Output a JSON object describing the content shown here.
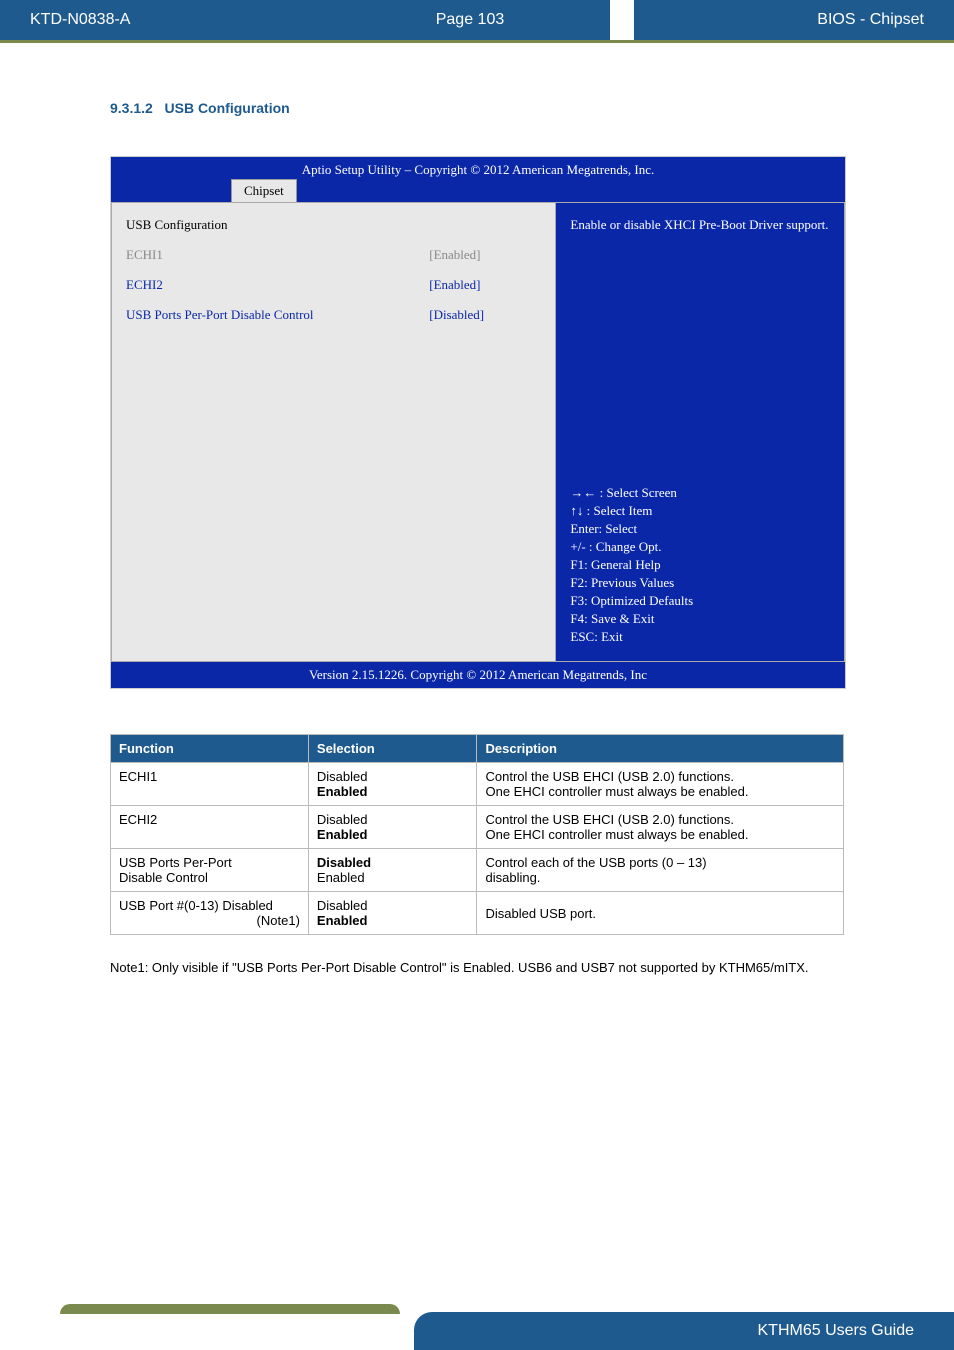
{
  "header": {
    "doc_id": "KTD-N0838-A",
    "page_label": "Page 103",
    "section_name": "BIOS - Chipset"
  },
  "section": {
    "number": "9.3.1.2",
    "title": "USB Configuration"
  },
  "bios": {
    "titlebar": "Aptio Setup Utility  –  Copyright © 2012 American Megatrends, Inc.",
    "tab": "Chipset",
    "heading": "USB Configuration",
    "rows": {
      "echi1": {
        "label": "ECHI1",
        "value": "[Enabled]"
      },
      "echi2": {
        "label": "ECHI2",
        "value": "[Enabled]"
      },
      "usbppd": {
        "label": "USB Ports Per-Port Disable Control",
        "value": "[Disabled]"
      }
    },
    "help_text": "Enable or disable XHCI Pre-Boot Driver support.",
    "keys": {
      "k1": "→← : Select Screen",
      "k2": "↑↓ : Select Item",
      "k3": "Enter: Select",
      "k4": "+/- : Change Opt.",
      "k5": "F1: General Help",
      "k6": "F2: Previous Values",
      "k7": "F3: Optimized Defaults",
      "k8": "F4: Save & Exit",
      "k9": "ESC: Exit"
    },
    "footer": "Version 2.15.1226. Copyright © 2012 American Megatrends, Inc"
  },
  "table": {
    "headers": {
      "function": "Function",
      "selection": "Selection",
      "description": "Description"
    },
    "rows": [
      {
        "function": "ECHI1",
        "sel_normal": "Disabled",
        "sel_default": "Enabled",
        "desc_l1": "Control the USB EHCI (USB 2.0) functions.",
        "desc_l2": "One EHCI controller must always be enabled."
      },
      {
        "function": "ECHI2",
        "sel_normal": "Disabled",
        "sel_default": "Enabled",
        "desc_l1": "Control the USB EHCI (USB 2.0) functions.",
        "desc_l2": "One EHCI controller must always be enabled."
      },
      {
        "function_l1": "USB Ports Per-Port",
        "function_l2": "Disable Control",
        "sel_default": "Disabled",
        "sel_normal": "Enabled",
        "desc_l1": "Control each of the USB ports (0 – 13)",
        "desc_l2": "disabling."
      },
      {
        "function_l1": "USB Port #(0-13) Disabled",
        "function_l2": "(Note1)",
        "sel_normal": "Disabled",
        "sel_default": "Enabled",
        "desc_l1": "Disabled USB port."
      }
    ]
  },
  "note": "Note1: Only visible if \"USB Ports Per-Port Disable Control\" is Enabled. USB6 and USB7 not supported by KTHM65/mITX.",
  "footer": {
    "guide": "KTHM65 Users Guide"
  }
}
